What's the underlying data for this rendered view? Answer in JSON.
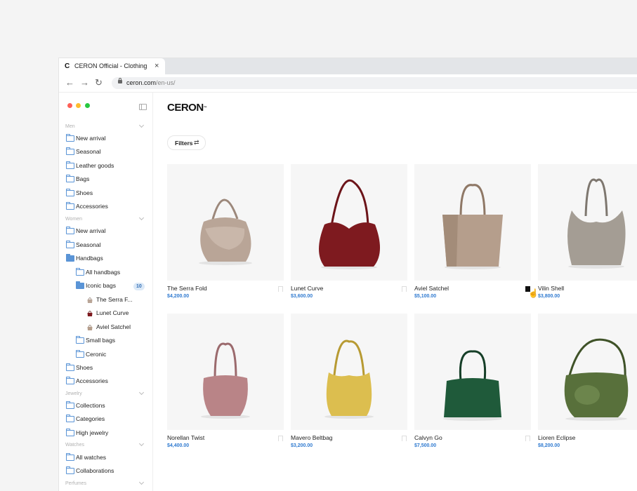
{
  "browser": {
    "tab_favicon": "C",
    "tab_title": "CERON Official - Clothing, Sh",
    "tab_close": "×",
    "url_host": "ceron.com",
    "url_path": "/en-us/",
    "nav_icons": [
      "arrow-left-icon",
      "arrow-right-icon",
      "reload-icon"
    ]
  },
  "window_lights": [
    "#fe5f57",
    "#febc2e",
    "#28c840"
  ],
  "sidebar": {
    "sections": [
      {
        "label": "Men",
        "items": [
          "New arrival",
          "Seasonal",
          "Leather goods",
          "Bags",
          "Shoes",
          "Accessories"
        ]
      },
      {
        "label": "Women",
        "items": [
          "New arrival",
          "Seasonal",
          "Handbags",
          "All handbags",
          "Iconic bags",
          "The Serra F...",
          "Lunet Curve",
          "Aviel Satchel",
          "Small bags",
          "Ceronic",
          "Shoes",
          "Accessories"
        ]
      },
      {
        "label": "Jewelry",
        "items": [
          "Collections",
          "Categories",
          "High jewelry"
        ]
      },
      {
        "label": "Watches",
        "items": [
          "All watches",
          "Collaborations"
        ]
      },
      {
        "label": "Perfumes",
        "items": []
      }
    ],
    "iconic_count": "10"
  },
  "main": {
    "logo": "CERON",
    "logo_mark": "™",
    "filters_label": "Filters",
    "filters_icon": "⇄",
    "products": [
      {
        "name": "The Serra Fold",
        "price": "$4,200.00",
        "color": "#b9a597"
      },
      {
        "name": "Lunet Curve",
        "price": "$3,600.00",
        "color": "#7e1a1f"
      },
      {
        "name": "Aviel Satchel",
        "price": "$5,100.00",
        "color": "#b59e8c"
      },
      {
        "name": "Vilin Shell",
        "price": "$3,800.00",
        "color": "#a49d94"
      },
      {
        "name": "Norellan Twist",
        "price": "$4,400.00",
        "color": "#b98487"
      },
      {
        "name": "Mavero Beltbag",
        "price": "$3,200.00",
        "color": "#dcbe4f"
      },
      {
        "name": "Calvyn Go",
        "price": "$7,500.00",
        "color": "#1f5a3a"
      },
      {
        "name": "Lioren Eclipse",
        "price": "$8,200.00",
        "color": "#58703b"
      }
    ]
  }
}
